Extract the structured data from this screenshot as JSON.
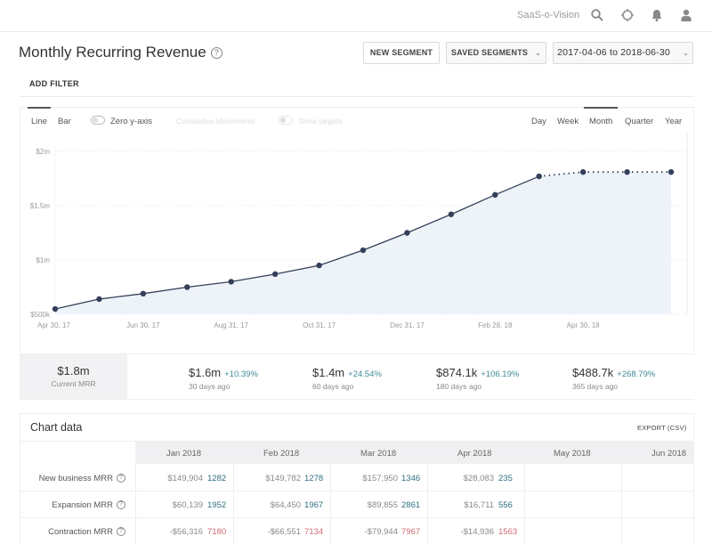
{
  "topbar": {
    "brand": "SaaS-o-Vision",
    "icons": [
      "search-icon",
      "settings-crosshair-icon",
      "bell-icon",
      "user-icon"
    ]
  },
  "header": {
    "title": "Monthly Recurring Revenue",
    "help_glyph": "?",
    "new_segment": "NEW SEGMENT",
    "saved_segments": "SAVED SEGMENTS",
    "date_range": "2017-04-06 to 2018-06-30",
    "chevron": "⌄",
    "add_filter": "ADD FILTER"
  },
  "controls": {
    "chart_types": [
      "Line",
      "Bar"
    ],
    "active_chart_type": "Line",
    "zero_y_axis": "Zero y-axis",
    "cumulative_movements": "Cumulative Movements",
    "show_targets": "Show targets",
    "intervals": [
      "Day",
      "Week",
      "Month",
      "Quarter",
      "Year"
    ],
    "active_interval": "Month"
  },
  "chart_data": {
    "type": "area",
    "title": "Monthly Recurring Revenue",
    "xlabel": "",
    "ylabel": "",
    "x": [
      "Apr 30, 17",
      "May 31, 17",
      "Jun 30, 17",
      "Jul 31, 17",
      "Aug 31, 17",
      "Sep 30, 17",
      "Oct 31, 17",
      "Nov 30, 17",
      "Dec 31, 17",
      "Jan 31, 18",
      "Feb 28, 18",
      "Mar 31, 18",
      "Apr 30, 18",
      "May 31, 18",
      "Jun 30, 18"
    ],
    "x_tick_labels": [
      "Apr 30, 17",
      "Jun 30, 17",
      "Aug 31, 17",
      "Oct 31, 17",
      "Dec 31, 17",
      "Feb 28, 18",
      "Apr 30, 18"
    ],
    "series": [
      {
        "name": "MRR",
        "values": [
          549000,
          640000,
          690000,
          750000,
          800000,
          870000,
          950000,
          1090000,
          1250000,
          1420000,
          1600000,
          1770000,
          1810000,
          1810000,
          1810000
        ],
        "projected_from_index": 11
      }
    ],
    "y_tick_labels": [
      "$500k",
      "$1m",
      "$1.5m",
      "$2m"
    ],
    "y_ticks": [
      500000,
      1000000,
      1500000,
      2000000
    ],
    "ylim": [
      500000,
      2000000
    ],
    "grid": true,
    "legend": "none"
  },
  "stats": {
    "current": {
      "value": "$1.8m",
      "label": "Current MRR"
    },
    "history": [
      {
        "value": "$1.6m",
        "change": "+10.39%",
        "label": "30 days ago"
      },
      {
        "value": "$1.4m",
        "change": "+24.54%",
        "label": "60 days ago"
      },
      {
        "value": "$874.1k",
        "change": "+106.19%",
        "label": "180 days ago"
      },
      {
        "value": "$488.7k",
        "change": "+268.79%",
        "label": "365 days ago"
      }
    ]
  },
  "table": {
    "title": "Chart data",
    "export": "EXPORT (CSV)",
    "columns": [
      "Jan 2018",
      "Feb 2018",
      "Mar 2018",
      "Apr 2018",
      "May 2018",
      "Jun 2018"
    ],
    "rows": [
      {
        "label": "New business MRR",
        "sign": "pos",
        "cells": [
          {
            "amount": "$149,904",
            "count": "1282"
          },
          {
            "amount": "$149,782",
            "count": "1278"
          },
          {
            "amount": "$157,950",
            "count": "1346"
          },
          {
            "amount": "$28,083",
            "count": "235"
          }
        ]
      },
      {
        "label": "Expansion MRR",
        "sign": "pos",
        "cells": [
          {
            "amount": "$60,139",
            "count": "1952"
          },
          {
            "amount": "$64,450",
            "count": "1967"
          },
          {
            "amount": "$89,855",
            "count": "2861"
          },
          {
            "amount": "$16,711",
            "count": "556"
          }
        ]
      },
      {
        "label": "Contraction MRR",
        "sign": "neg",
        "cells": [
          {
            "amount": "-$56,316",
            "count": "7180"
          },
          {
            "amount": "-$66,551",
            "count": "7134"
          },
          {
            "amount": "-$79,944",
            "count": "7967"
          },
          {
            "amount": "-$14,936",
            "count": "1563"
          }
        ]
      }
    ]
  },
  "colors": {
    "line": "#34405a",
    "area": "#eef3f9",
    "positive": "#2f6f82",
    "negative": "#d06a72",
    "change": "#3f8a98"
  }
}
